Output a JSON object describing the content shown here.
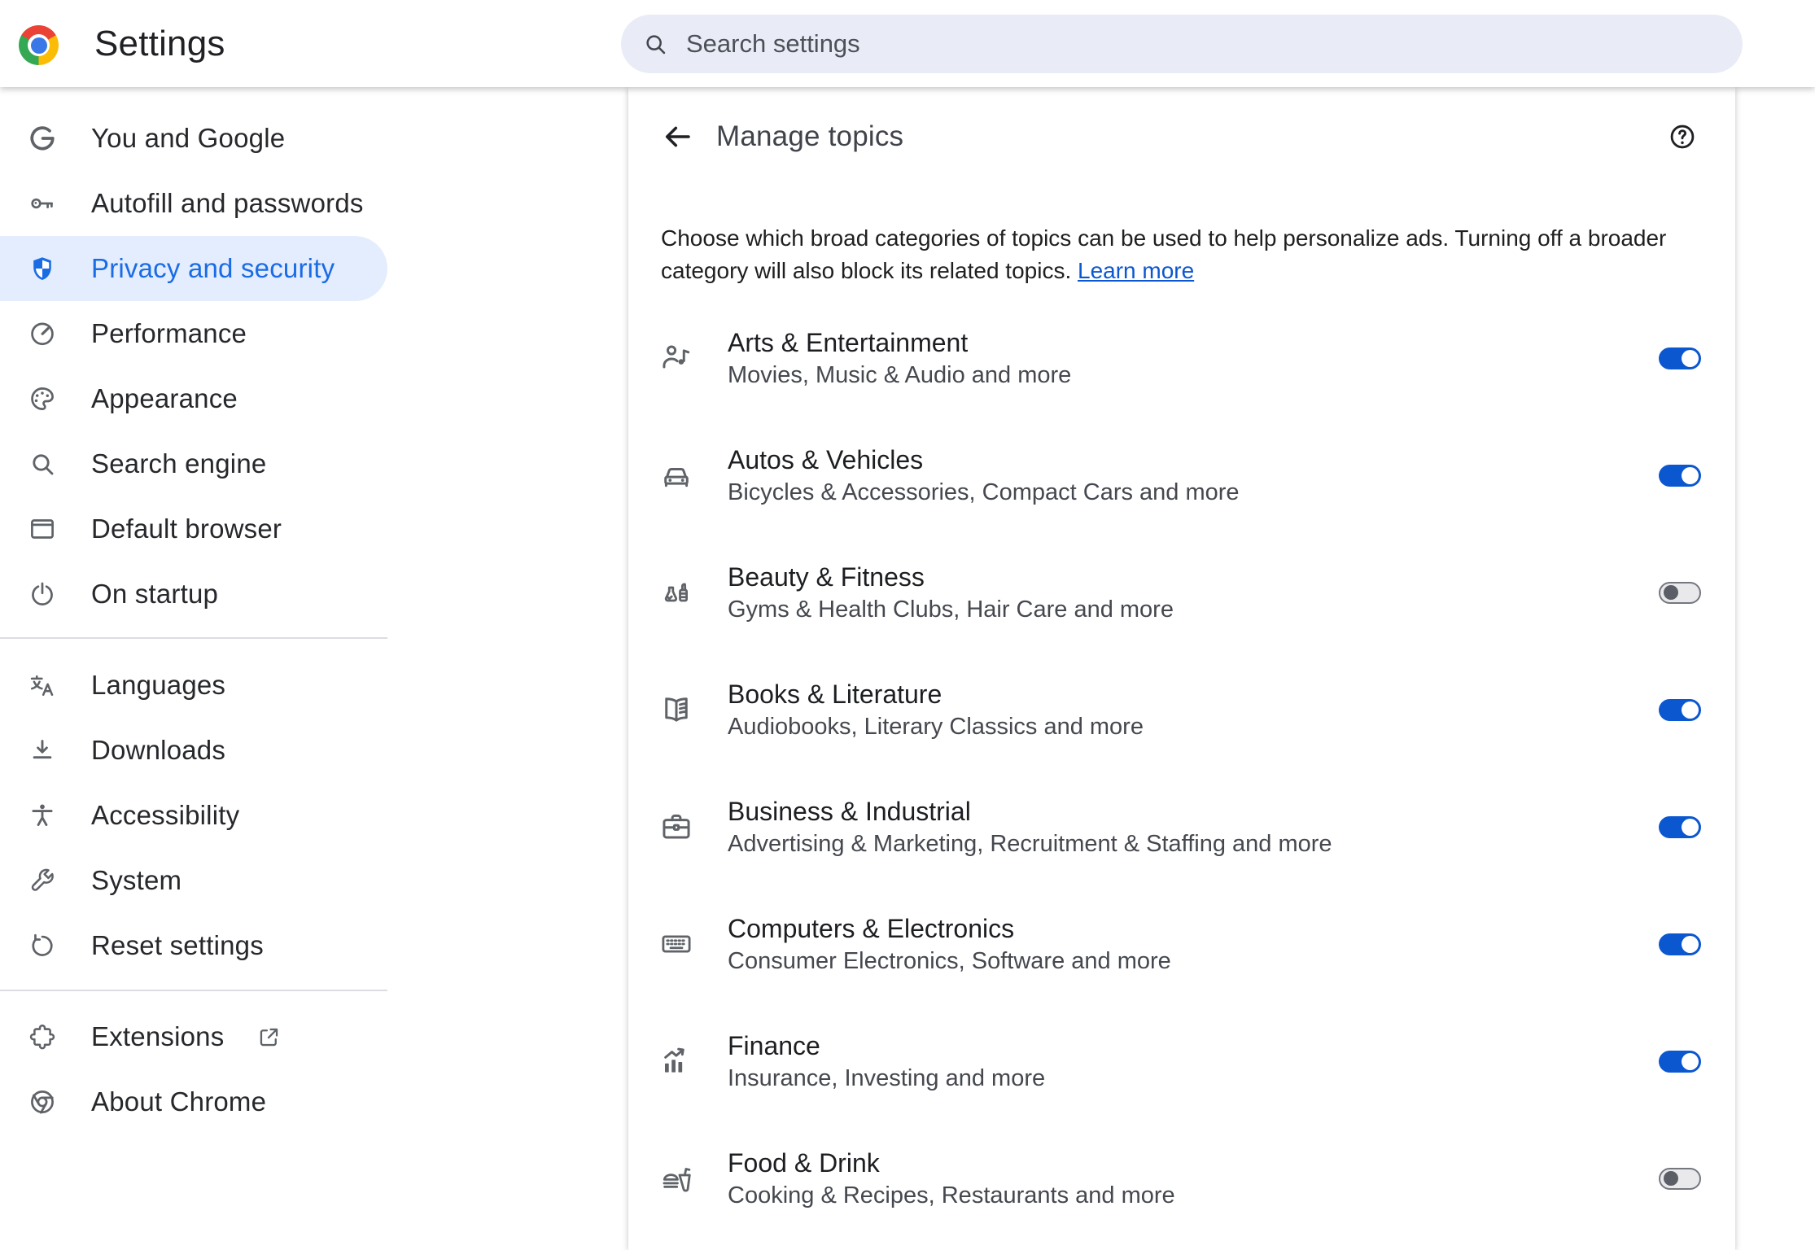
{
  "header": {
    "title": "Settings",
    "search_placeholder": "Search settings",
    "logo": "chrome-logo"
  },
  "sidebar": {
    "groups": [
      {
        "items": [
          {
            "id": "you-and-google",
            "label": "You and Google",
            "icon": "google-g-icon",
            "selected": false
          },
          {
            "id": "autofill-and-passwords",
            "label": "Autofill and passwords",
            "icon": "key-icon",
            "selected": false
          },
          {
            "id": "privacy-and-security",
            "label": "Privacy and security",
            "icon": "shield-icon",
            "selected": true
          },
          {
            "id": "performance",
            "label": "Performance",
            "icon": "speedometer-icon",
            "selected": false
          },
          {
            "id": "appearance",
            "label": "Appearance",
            "icon": "palette-icon",
            "selected": false
          },
          {
            "id": "search-engine",
            "label": "Search engine",
            "icon": "search-icon",
            "selected": false
          },
          {
            "id": "default-browser",
            "label": "Default browser",
            "icon": "browser-icon",
            "selected": false
          },
          {
            "id": "on-startup",
            "label": "On startup",
            "icon": "power-icon",
            "selected": false
          }
        ]
      },
      {
        "items": [
          {
            "id": "languages",
            "label": "Languages",
            "icon": "translate-icon",
            "selected": false
          },
          {
            "id": "downloads",
            "label": "Downloads",
            "icon": "download-icon",
            "selected": false
          },
          {
            "id": "accessibility",
            "label": "Accessibility",
            "icon": "accessibility-icon",
            "selected": false
          },
          {
            "id": "system",
            "label": "System",
            "icon": "wrench-icon",
            "selected": false
          },
          {
            "id": "reset-settings",
            "label": "Reset settings",
            "icon": "reset-icon",
            "selected": false
          }
        ]
      },
      {
        "items": [
          {
            "id": "extensions",
            "label": "Extensions",
            "icon": "puzzle-icon",
            "external": true,
            "selected": false
          },
          {
            "id": "about-chrome",
            "label": "About Chrome",
            "icon": "chrome-icon",
            "selected": false
          }
        ]
      }
    ]
  },
  "content": {
    "toolbar": {
      "title": "Manage topics",
      "back_icon": "arrow-left-icon",
      "help_icon": "help-icon"
    },
    "description": {
      "text": "Choose which broad categories of topics can be used to help personalize ads. Turning off a broader category will also block its related topics. ",
      "link_label": "Learn more"
    },
    "topics": [
      {
        "id": "arts-entertainment",
        "name": "Arts & Entertainment",
        "subtitle": "Movies, Music & Audio and more",
        "icon": "person-music-icon",
        "enabled": true
      },
      {
        "id": "autos-vehicles",
        "name": "Autos & Vehicles",
        "subtitle": "Bicycles & Accessories, Compact Cars and more",
        "icon": "car-icon",
        "enabled": true
      },
      {
        "id": "beauty-fitness",
        "name": "Beauty & Fitness",
        "subtitle": "Gyms & Health Clubs, Hair Care and more",
        "icon": "beauty-icon",
        "enabled": false
      },
      {
        "id": "books-literature",
        "name": "Books & Literature",
        "subtitle": "Audiobooks, Literary Classics and more",
        "icon": "book-icon",
        "enabled": true
      },
      {
        "id": "business-industrial",
        "name": "Business & Industrial",
        "subtitle": "Advertising & Marketing, Recruitment & Staffing and more",
        "icon": "briefcase-icon",
        "enabled": true
      },
      {
        "id": "computers-electronics",
        "name": "Computers & Electronics",
        "subtitle": "Consumer Electronics, Software and more",
        "icon": "keyboard-icon",
        "enabled": true
      },
      {
        "id": "finance",
        "name": "Finance",
        "subtitle": "Insurance, Investing and more",
        "icon": "finance-icon",
        "enabled": true
      },
      {
        "id": "food-drink",
        "name": "Food & Drink",
        "subtitle": "Cooking & Recipes, Restaurants and more",
        "icon": "food-icon",
        "enabled": false
      }
    ]
  },
  "colors": {
    "accent_blue": "#1a6ce5",
    "control_blue": "#0b57d0",
    "selected_item_bg": "#e4edfd",
    "search_bg": "#e9ecf6",
    "icon_gray": "#5f6368",
    "text_primary": "#1f1f1f",
    "text_secondary": "#45484e",
    "toggle_off_track": "#e9e9ec",
    "toggle_off_border": "#74777f",
    "toggle_off_knob": "#5b5e66"
  }
}
